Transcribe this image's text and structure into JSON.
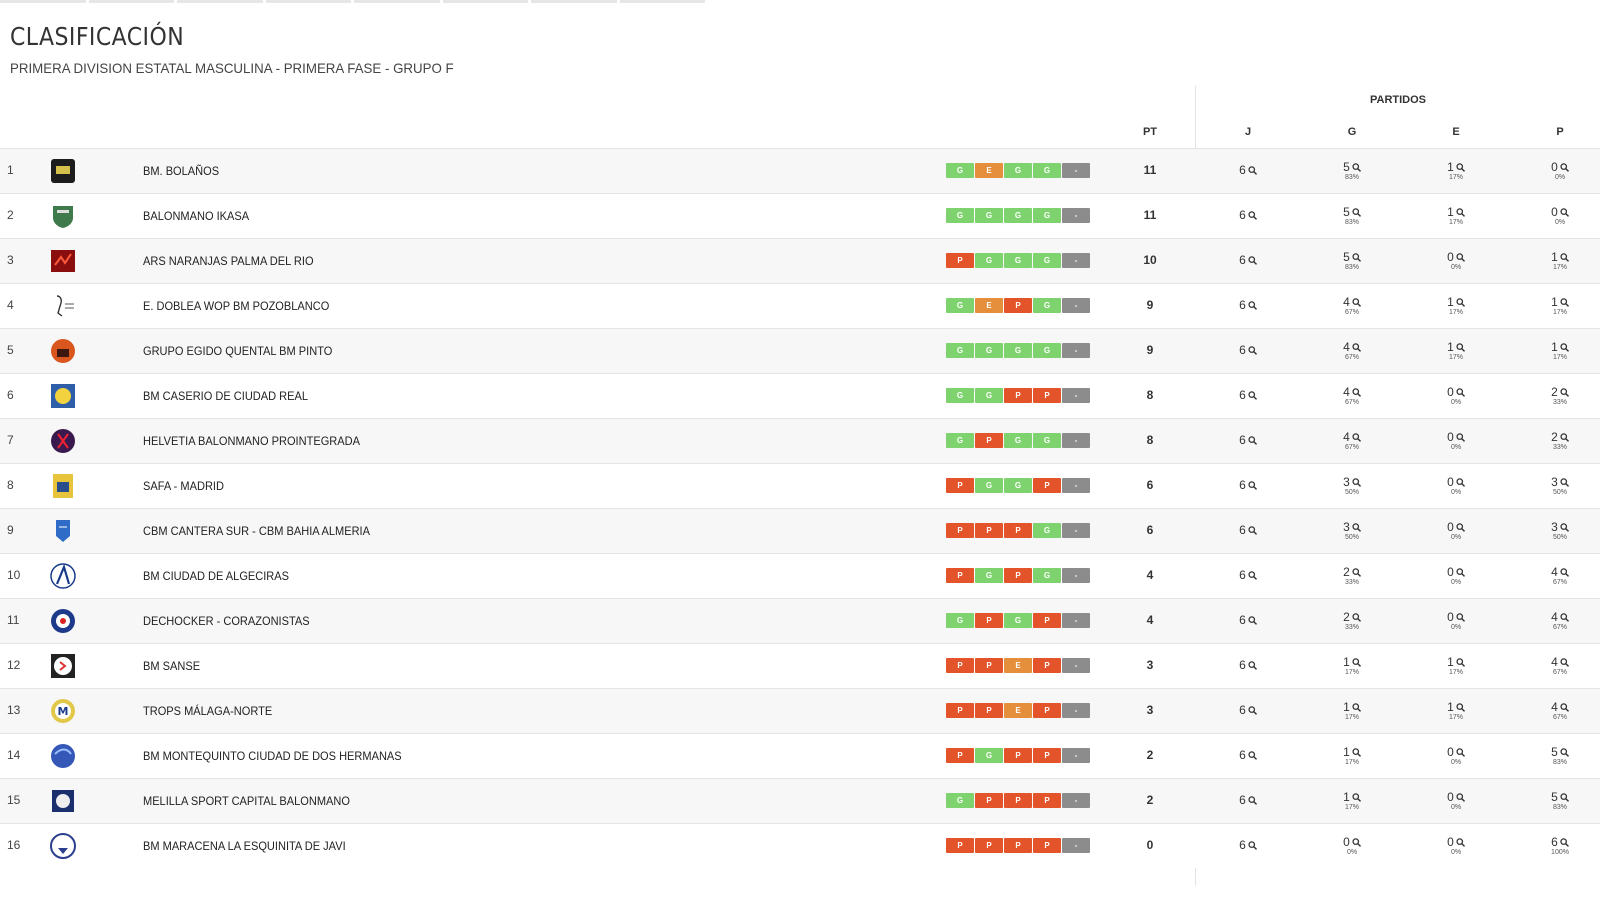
{
  "header": {
    "title": "CLASIFICACIÓN",
    "subtitle": "PRIMERA DIVISION ESTATAL MASCULINA - PRIMERA FASE - GRUPO F"
  },
  "columns": {
    "group": "PARTIDOS",
    "pt": "PT",
    "j": "J",
    "g": "G",
    "e": "E",
    "p": "P"
  },
  "colors": {
    "win": "#7ed36f",
    "draw": "#e58e3b",
    "loss": "#e3542a",
    "pending": "#8c8c8c"
  },
  "icons": {
    "stat": "magnifier-icon"
  },
  "rows": [
    {
      "pos": "1",
      "team": "BM. BOLAÑOS",
      "form": [
        "G",
        "E",
        "G",
        "G",
        "-"
      ],
      "pt": "11",
      "j": "6",
      "g": "5",
      "gp": "83%",
      "e": "1",
      "ep": "17%",
      "p": "0",
      "pp": "0%"
    },
    {
      "pos": "2",
      "team": "BALONMANO IKASA",
      "form": [
        "G",
        "G",
        "G",
        "G",
        "-"
      ],
      "pt": "11",
      "j": "6",
      "g": "5",
      "gp": "83%",
      "e": "1",
      "ep": "17%",
      "p": "0",
      "pp": "0%"
    },
    {
      "pos": "3",
      "team": "ARS NARANJAS PALMA DEL RIO",
      "form": [
        "P",
        "G",
        "G",
        "G",
        "-"
      ],
      "pt": "10",
      "j": "6",
      "g": "5",
      "gp": "83%",
      "e": "0",
      "ep": "0%",
      "p": "1",
      "pp": "17%"
    },
    {
      "pos": "4",
      "team": "E. DOBLEA WOP BM POZOBLANCO",
      "form": [
        "G",
        "E",
        "P",
        "G",
        "-"
      ],
      "pt": "9",
      "j": "6",
      "g": "4",
      "gp": "67%",
      "e": "1",
      "ep": "17%",
      "p": "1",
      "pp": "17%"
    },
    {
      "pos": "5",
      "team": "GRUPO EGIDO QUENTAL BM PINTO",
      "form": [
        "G",
        "G",
        "G",
        "G",
        "-"
      ],
      "pt": "9",
      "j": "6",
      "g": "4",
      "gp": "67%",
      "e": "1",
      "ep": "17%",
      "p": "1",
      "pp": "17%"
    },
    {
      "pos": "6",
      "team": "BM CASERIO DE CIUDAD REAL",
      "form": [
        "G",
        "G",
        "P",
        "P",
        "-"
      ],
      "pt": "8",
      "j": "6",
      "g": "4",
      "gp": "67%",
      "e": "0",
      "ep": "0%",
      "p": "2",
      "pp": "33%"
    },
    {
      "pos": "7",
      "team": "HELVETIA BALONMANO PROINTEGRADA",
      "form": [
        "G",
        "P",
        "G",
        "G",
        "-"
      ],
      "pt": "8",
      "j": "6",
      "g": "4",
      "gp": "67%",
      "e": "0",
      "ep": "0%",
      "p": "2",
      "pp": "33%"
    },
    {
      "pos": "8",
      "team": "SAFA - MADRID",
      "form": [
        "P",
        "G",
        "G",
        "P",
        "-"
      ],
      "pt": "6",
      "j": "6",
      "g": "3",
      "gp": "50%",
      "e": "0",
      "ep": "0%",
      "p": "3",
      "pp": "50%"
    },
    {
      "pos": "9",
      "team": "CBM CANTERA SUR - CBM BAHIA ALMERIA",
      "form": [
        "P",
        "P",
        "P",
        "G",
        "-"
      ],
      "pt": "6",
      "j": "6",
      "g": "3",
      "gp": "50%",
      "e": "0",
      "ep": "0%",
      "p": "3",
      "pp": "50%"
    },
    {
      "pos": "10",
      "team": "BM CIUDAD DE ALGECIRAS",
      "form": [
        "P",
        "G",
        "P",
        "G",
        "-"
      ],
      "pt": "4",
      "j": "6",
      "g": "2",
      "gp": "33%",
      "e": "0",
      "ep": "0%",
      "p": "4",
      "pp": "67%"
    },
    {
      "pos": "11",
      "team": "DECHOCKER - CORAZONISTAS",
      "form": [
        "G",
        "P",
        "G",
        "P",
        "-"
      ],
      "pt": "4",
      "j": "6",
      "g": "2",
      "gp": "33%",
      "e": "0",
      "ep": "0%",
      "p": "4",
      "pp": "67%"
    },
    {
      "pos": "12",
      "team": "BM SANSE",
      "form": [
        "P",
        "P",
        "E",
        "P",
        "-"
      ],
      "pt": "3",
      "j": "6",
      "g": "1",
      "gp": "17%",
      "e": "1",
      "ep": "17%",
      "p": "4",
      "pp": "67%"
    },
    {
      "pos": "13",
      "team": "TROPS MÁLAGA-NORTE",
      "form": [
        "P",
        "P",
        "E",
        "P",
        "-"
      ],
      "pt": "3",
      "j": "6",
      "g": "1",
      "gp": "17%",
      "e": "1",
      "ep": "17%",
      "p": "4",
      "pp": "67%"
    },
    {
      "pos": "14",
      "team": "BM MONTEQUINTO CIUDAD DE DOS HERMANAS",
      "form": [
        "P",
        "G",
        "P",
        "P",
        "-"
      ],
      "pt": "2",
      "j": "6",
      "g": "1",
      "gp": "17%",
      "e": "0",
      "ep": "0%",
      "p": "5",
      "pp": "83%"
    },
    {
      "pos": "15",
      "team": "MELILLA SPORT CAPITAL BALONMANO",
      "form": [
        "G",
        "P",
        "P",
        "P",
        "-"
      ],
      "pt": "2",
      "j": "6",
      "g": "1",
      "gp": "17%",
      "e": "0",
      "ep": "0%",
      "p": "5",
      "pp": "83%"
    },
    {
      "pos": "16",
      "team": "BM MARACENA LA ESQUINITA DE JAVI",
      "form": [
        "P",
        "P",
        "P",
        "P",
        "-"
      ],
      "pt": "0",
      "j": "6",
      "g": "0",
      "gp": "0%",
      "e": "0",
      "ep": "0%",
      "p": "6",
      "pp": "100%"
    }
  ]
}
